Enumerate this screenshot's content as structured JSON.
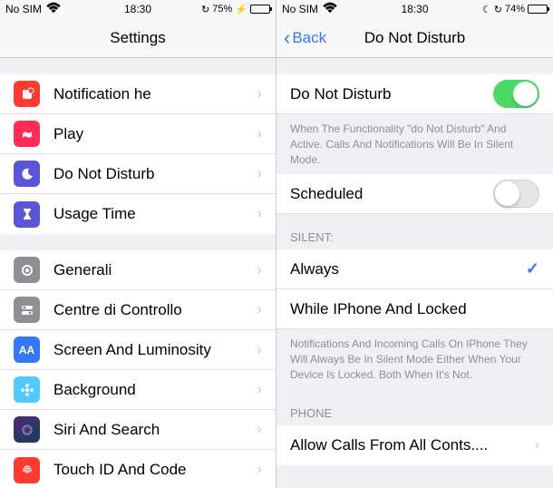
{
  "left": {
    "status": {
      "carrier": "No SIM",
      "time": "18:30",
      "battery": "75%"
    },
    "nav": {
      "title": "Settings"
    },
    "group1": [
      {
        "label": "Notification he",
        "icon": "notification",
        "bg": "#ff3b30"
      },
      {
        "label": "Play",
        "icon": "play",
        "bg": "#ff2d55"
      },
      {
        "label": "Do Not Disturb",
        "icon": "moon",
        "bg": "#5856d6"
      },
      {
        "label": "Usage Time",
        "icon": "hourglass",
        "bg": "#5856d6"
      }
    ],
    "group2": [
      {
        "label": "Generali",
        "icon": "gear",
        "bg": "#8e8e93"
      },
      {
        "label": "Centre di Controllo",
        "icon": "switches",
        "bg": "#8e8e93"
      },
      {
        "label": "Screen And Luminosity",
        "icon": "aa",
        "bg": "#3478f6"
      },
      {
        "label": "Background",
        "icon": "flower",
        "bg": "#54c7fc"
      },
      {
        "label": "Siri And Search",
        "icon": "siri",
        "bg": "#222"
      },
      {
        "label": "Touch ID And Code",
        "icon": "fingerprint",
        "bg": "#ff3b30"
      }
    ]
  },
  "right": {
    "status": {
      "carrier": "No SIM",
      "time": "18:30",
      "battery": "74%"
    },
    "nav": {
      "back": "Back",
      "title": "Do Not Disturb"
    },
    "dnd": {
      "label": "Do Not Disturb",
      "footer": "When The Functionality \"do Not Disturb\" And Active. Calls And Notifications Will Be In Silent Mode."
    },
    "scheduled": {
      "label": "Scheduled"
    },
    "silent": {
      "header": "SILENT:",
      "always": "Always",
      "locked": "While IPhone And Locked",
      "footer": "Notifications And Incoming Calls On IPhone They Will Always Be In Silent Mode Either When Your Device Is Locked. Both When It's Not."
    },
    "phone": {
      "header": "PHONE",
      "allow": "Allow Calls From All Conts...."
    }
  }
}
